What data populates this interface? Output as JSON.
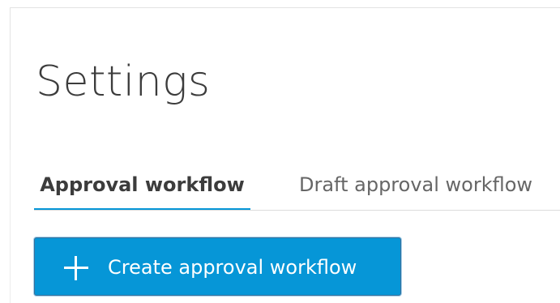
{
  "page": {
    "title": "Settings"
  },
  "tabs": [
    {
      "label": "Approval workflow",
      "active": true
    },
    {
      "label": "Draft approval workflow",
      "active": false
    }
  ],
  "actions": {
    "create_label": "Create approval workflow",
    "create_icon": "plus-icon"
  },
  "colors": {
    "accent": "#0696d7",
    "text_primary": "#3c3c3c",
    "text_secondary": "#666666",
    "divider": "#dcdcdc"
  }
}
